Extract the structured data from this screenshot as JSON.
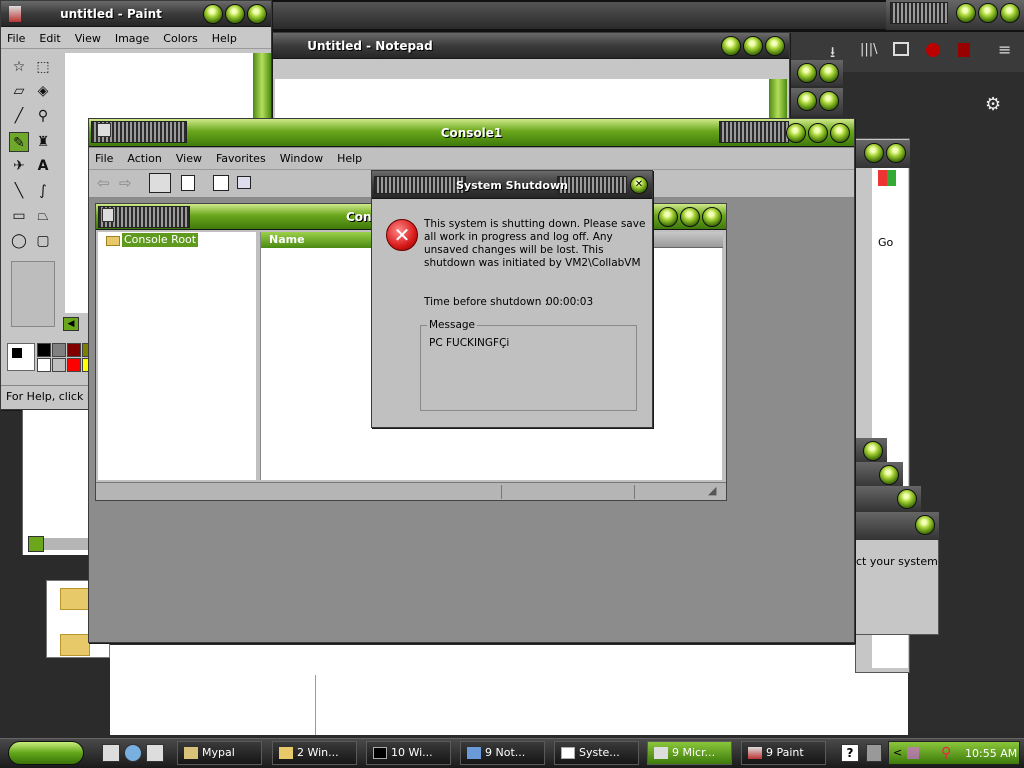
{
  "paint": {
    "title": "untitled - Paint",
    "menu": [
      "File",
      "Edit",
      "View",
      "Image",
      "Colors",
      "Help"
    ],
    "status": "For Help, click He"
  },
  "notepad": {
    "title": "Untitled - Notepad"
  },
  "console": {
    "title": "Console1",
    "menu": [
      "File",
      "Action",
      "View",
      "Favorites",
      "Window",
      "Help"
    ],
    "inner_title": "Cons",
    "tree_root": "Console Root",
    "col_name": "Name",
    "go": "Go",
    "snippet": "ct your system"
  },
  "dialog": {
    "title": "System Shutdown",
    "message": "This system is shutting down. Please save all work in progress and log off. Any unsaved changes will be lost. This shutdown was initiated by VM2\\CollabVM",
    "time_label": "Time before shutdown :",
    "time_value": "00:00:03",
    "group_label": "Message",
    "user_message": "PC FUCKINGFÇi"
  },
  "taskbar": {
    "items": [
      "Mypal",
      "2 Win...",
      "10 Wi...",
      "9 Not...",
      "Syste...",
      "9 Micr...",
      "9 Paint"
    ],
    "clock": "10:55 AM"
  }
}
